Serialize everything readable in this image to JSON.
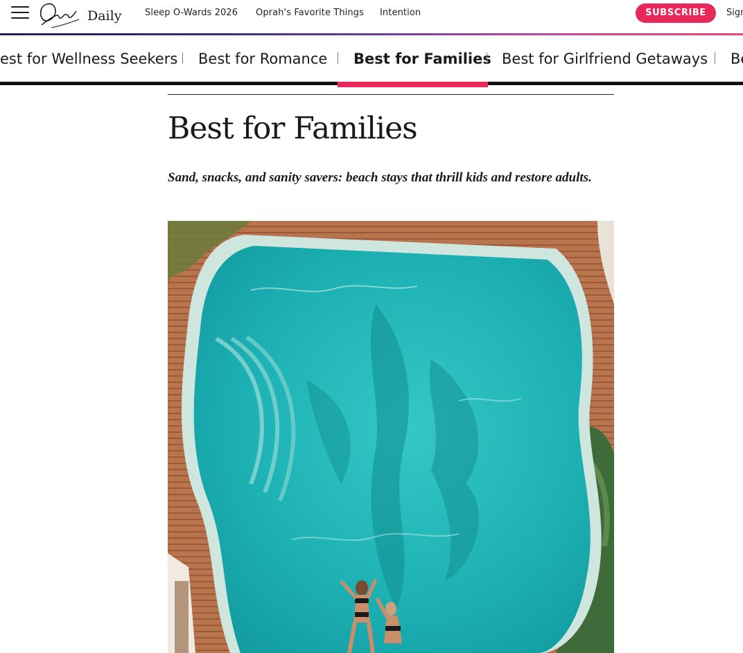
{
  "header": {
    "logo_text": "Oprah Daily",
    "nav_links": [
      {
        "label": "Sleep O-Wards 2026"
      },
      {
        "label": "Oprah's Favorite Things"
      },
      {
        "label": "Intention"
      }
    ],
    "subscribe_label": "SUBSCRIBE",
    "signin_label": "Sign"
  },
  "tabs": [
    {
      "label": "est for Wellness Seekers",
      "active": false
    },
    {
      "label": "Best for Romance",
      "active": false
    },
    {
      "label": "Best for Families",
      "active": true
    },
    {
      "label": "Best for Girlfriend Getaways",
      "active": false
    },
    {
      "label": "Be",
      "active": false
    }
  ],
  "article": {
    "section_title": "Best for Families",
    "dek": "Sand, snacks, and sanity savers: beach stays that thrill kids and restore adults."
  },
  "colors": {
    "accent": "#e8285a",
    "pool_water": "#1fb5b5",
    "deck_wood": "#b56a44"
  },
  "icons": {
    "menu": "hamburger-menu-icon"
  }
}
